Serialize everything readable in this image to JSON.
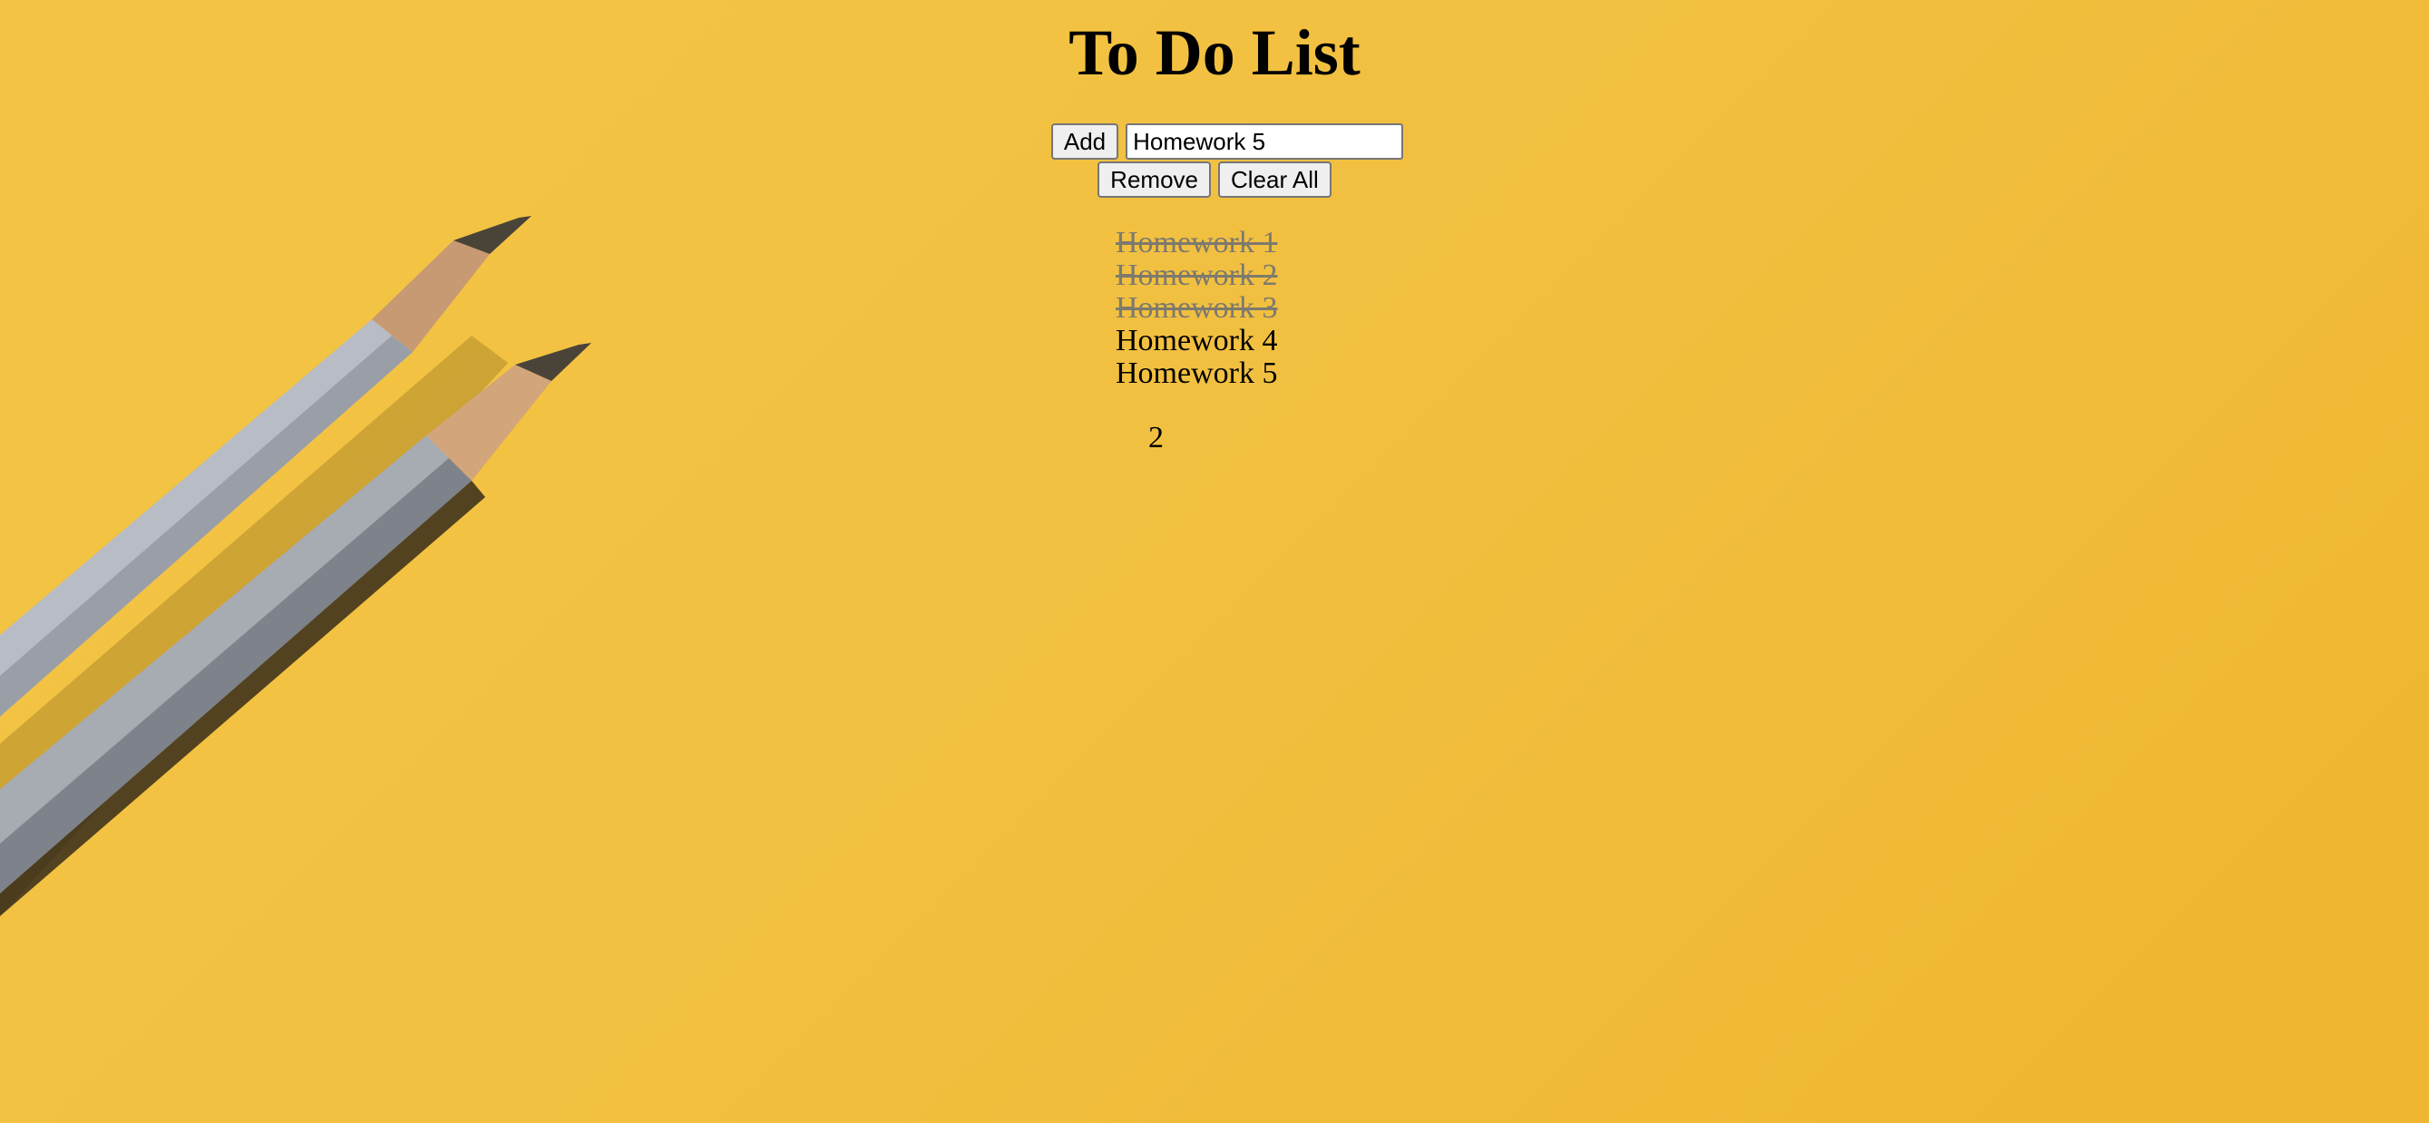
{
  "page": {
    "title": "To Do List",
    "background_color": "#f2c040"
  },
  "controls": {
    "add_label": "Add",
    "input_value": "Homework 5",
    "remove_label": "Remove",
    "clear_all_label": "Clear All"
  },
  "tasks": [
    {
      "label": "Homework 1",
      "done": true
    },
    {
      "label": "Homework 2",
      "done": true
    },
    {
      "label": "Homework 3",
      "done": true
    },
    {
      "label": "Homework 4",
      "done": false
    },
    {
      "label": "Homework 5",
      "done": false
    }
  ],
  "remaining_count": "2",
  "decor": {
    "icon": "pencils-background"
  }
}
